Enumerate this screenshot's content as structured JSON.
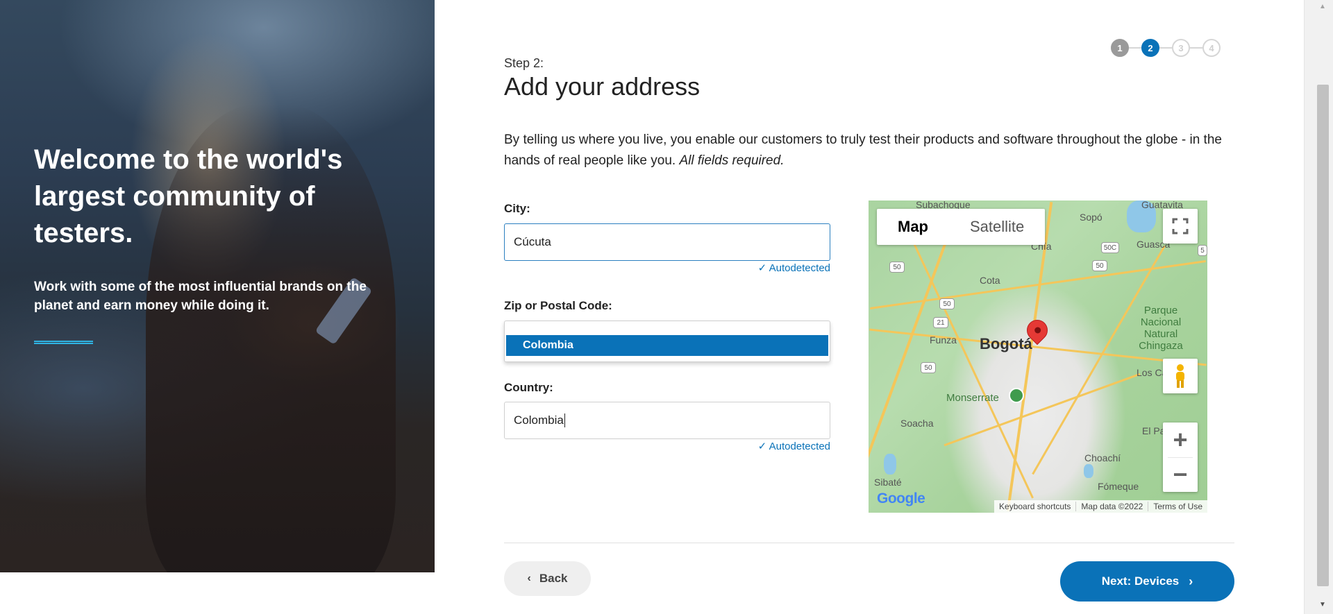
{
  "hero": {
    "headline": "Welcome to the world's largest community of testers.",
    "subtext": "Work with some of the most influential brands on the planet and earn money while doing it."
  },
  "stepper": {
    "steps": [
      "1",
      "2",
      "3",
      "4"
    ],
    "current": 2
  },
  "header": {
    "step_label": "Step 2:",
    "title": "Add your address"
  },
  "intro": {
    "text": "By telling us where you live, you enable our customers to truly test their products and software throughout the globe - in the hands of real people like you.",
    "emphasis": "All fields required."
  },
  "form": {
    "city": {
      "label": "City:",
      "value": "Cúcuta",
      "note": "Autodetected"
    },
    "zip": {
      "label": "Zip or Postal Code:",
      "suggestion": "Colombia"
    },
    "country": {
      "label": "Country:",
      "value": "Colombia",
      "note": "Autodetected"
    }
  },
  "map": {
    "type_map": "Map",
    "type_satellite": "Satellite",
    "labels": {
      "subachoque": "Subachoque",
      "guatavita": "Guatavita",
      "sopo": "Sopó",
      "chia": "Chía",
      "guasca": "Guasca",
      "cota": "Cota",
      "parque": "Parque\nNacional\nNatural\nChingaza",
      "funza": "Funza",
      "bogota": "Bogotá",
      "monserrate": "Monserrate",
      "los_ca": "Los Ca",
      "soacha": "Soacha",
      "el_pa": "El Pa",
      "choachi": "Choachí",
      "sibate": "Sibaté",
      "fomeque": "Fómeque"
    },
    "shields": [
      "50",
      "50",
      "50C",
      "50",
      "21",
      "50",
      "5"
    ],
    "footer": {
      "shortcuts": "Keyboard shortcuts",
      "data": "Map data ©2022",
      "terms": "Terms of Use"
    },
    "logo": "Google"
  },
  "footer": {
    "back_label": "Back",
    "next_label": "Next: Devices"
  },
  "colors": {
    "primary": "#0a72b8",
    "accent_line": "#2fb5e5"
  }
}
